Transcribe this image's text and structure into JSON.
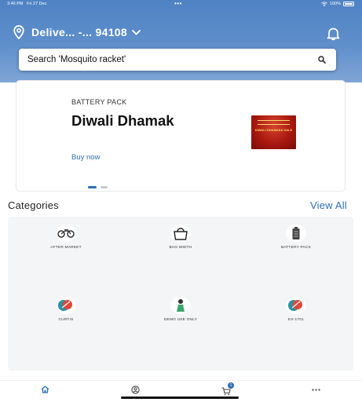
{
  "status_bar": {
    "time": "3:46 PM",
    "date": "Fri 27 Dec",
    "dots": "•••",
    "battery": "100%"
  },
  "header": {
    "location_label": "Delive...   -... 94108",
    "search_text": "Search 'Mosquito racket'"
  },
  "banner": {
    "kicker": "BATTERY PACK",
    "title": "Diwali Dhamak",
    "cta": "Buy now",
    "image_text": "DIWALI DHAMAKA SALE"
  },
  "categories": {
    "title": "Categories",
    "view_all": "View All",
    "items": [
      {
        "label": "AFTER MARKET",
        "icon": "motorbike-parts-icon"
      },
      {
        "label": "BAG WIDTH",
        "icon": "bag-icon"
      },
      {
        "label": "BATTERY PACK",
        "icon": "battery-icon"
      },
      {
        "label": "CURTIS",
        "icon": "curtis-logo-icon"
      },
      {
        "label": "DEMO USE ONLY",
        "icon": "demo-figure-icon"
      },
      {
        "label": "EX-1701",
        "icon": "ex-logo-icon"
      }
    ]
  },
  "bottom_nav": {
    "items": [
      "home-icon",
      "profile-icon",
      "cart-icon",
      "more-icon"
    ],
    "cart_count": "1"
  },
  "colors": {
    "header": "#5a8ac9",
    "accent": "#2d6fb3"
  }
}
